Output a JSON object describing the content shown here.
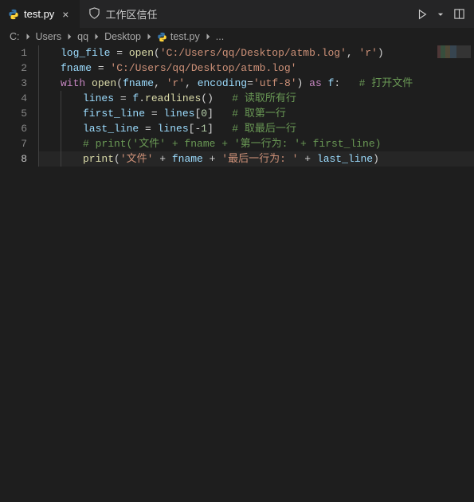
{
  "tab": {
    "filename": "test.py",
    "close_glyph": "×"
  },
  "trust": {
    "label": "工作区信任"
  },
  "breadcrumbs": {
    "items": [
      "C:",
      "Users",
      "qq",
      "Desktop",
      "test.py",
      "..."
    ],
    "file_index": 4
  },
  "editor": {
    "line_count": 8,
    "current_line": 8,
    "tokens": [
      [
        {
          "t": "var",
          "v": "log_file"
        },
        {
          "t": "op",
          "v": " = "
        },
        {
          "t": "fn",
          "v": "open"
        },
        {
          "t": "op",
          "v": "("
        },
        {
          "t": "str",
          "v": "'C:/Users/qq/Desktop/atmb.log'"
        },
        {
          "t": "op",
          "v": ", "
        },
        {
          "t": "str",
          "v": "'r'"
        },
        {
          "t": "op",
          "v": ")"
        }
      ],
      [
        {
          "t": "var",
          "v": "fname"
        },
        {
          "t": "op",
          "v": " = "
        },
        {
          "t": "str",
          "v": "'C:/Users/qq/Desktop/atmb.log'"
        }
      ],
      [
        {
          "t": "kw",
          "v": "with"
        },
        {
          "t": "op",
          "v": " "
        },
        {
          "t": "fn",
          "v": "open"
        },
        {
          "t": "op",
          "v": "("
        },
        {
          "t": "var",
          "v": "fname"
        },
        {
          "t": "op",
          "v": ", "
        },
        {
          "t": "str",
          "v": "'r'"
        },
        {
          "t": "op",
          "v": ", "
        },
        {
          "t": "var",
          "v": "encoding"
        },
        {
          "t": "op",
          "v": "="
        },
        {
          "t": "str",
          "v": "'utf-8'"
        },
        {
          "t": "op",
          "v": ") "
        },
        {
          "t": "kw",
          "v": "as"
        },
        {
          "t": "op",
          "v": " "
        },
        {
          "t": "var",
          "v": "f"
        },
        {
          "t": "op",
          "v": ":   "
        },
        {
          "t": "cmt",
          "v": "# 打开文件"
        }
      ],
      [
        {
          "t": "var",
          "v": "lines"
        },
        {
          "t": "op",
          "v": " = "
        },
        {
          "t": "var",
          "v": "f"
        },
        {
          "t": "op",
          "v": "."
        },
        {
          "t": "fn",
          "v": "readlines"
        },
        {
          "t": "op",
          "v": "()   "
        },
        {
          "t": "cmt",
          "v": "# 读取所有行"
        }
      ],
      [
        {
          "t": "var",
          "v": "first_line"
        },
        {
          "t": "op",
          "v": " = "
        },
        {
          "t": "var",
          "v": "lines"
        },
        {
          "t": "op",
          "v": "["
        },
        {
          "t": "num",
          "v": "0"
        },
        {
          "t": "op",
          "v": "]   "
        },
        {
          "t": "cmt",
          "v": "# 取第一行"
        }
      ],
      [
        {
          "t": "var",
          "v": "last_line"
        },
        {
          "t": "op",
          "v": " = "
        },
        {
          "t": "var",
          "v": "lines"
        },
        {
          "t": "op",
          "v": "["
        },
        {
          "t": "op",
          "v": "-"
        },
        {
          "t": "num",
          "v": "1"
        },
        {
          "t": "op",
          "v": "]   "
        },
        {
          "t": "cmt",
          "v": "# 取最后一行"
        }
      ],
      [
        {
          "t": "cmt",
          "v": "# print('文件' + fname + '第一行为: '+ first_line)"
        }
      ],
      [
        {
          "t": "fn",
          "v": "print"
        },
        {
          "t": "op",
          "v": "("
        },
        {
          "t": "str",
          "v": "'文件'"
        },
        {
          "t": "op",
          "v": " + "
        },
        {
          "t": "var",
          "v": "fname"
        },
        {
          "t": "op",
          "v": " + "
        },
        {
          "t": "str",
          "v": "'最后一行为: '"
        },
        {
          "t": "op",
          "v": " + "
        },
        {
          "t": "var",
          "v": "last_line"
        },
        {
          "t": "op",
          "v": ")"
        }
      ]
    ],
    "indents": [
      0,
      0,
      0,
      1,
      1,
      1,
      1,
      1
    ]
  }
}
